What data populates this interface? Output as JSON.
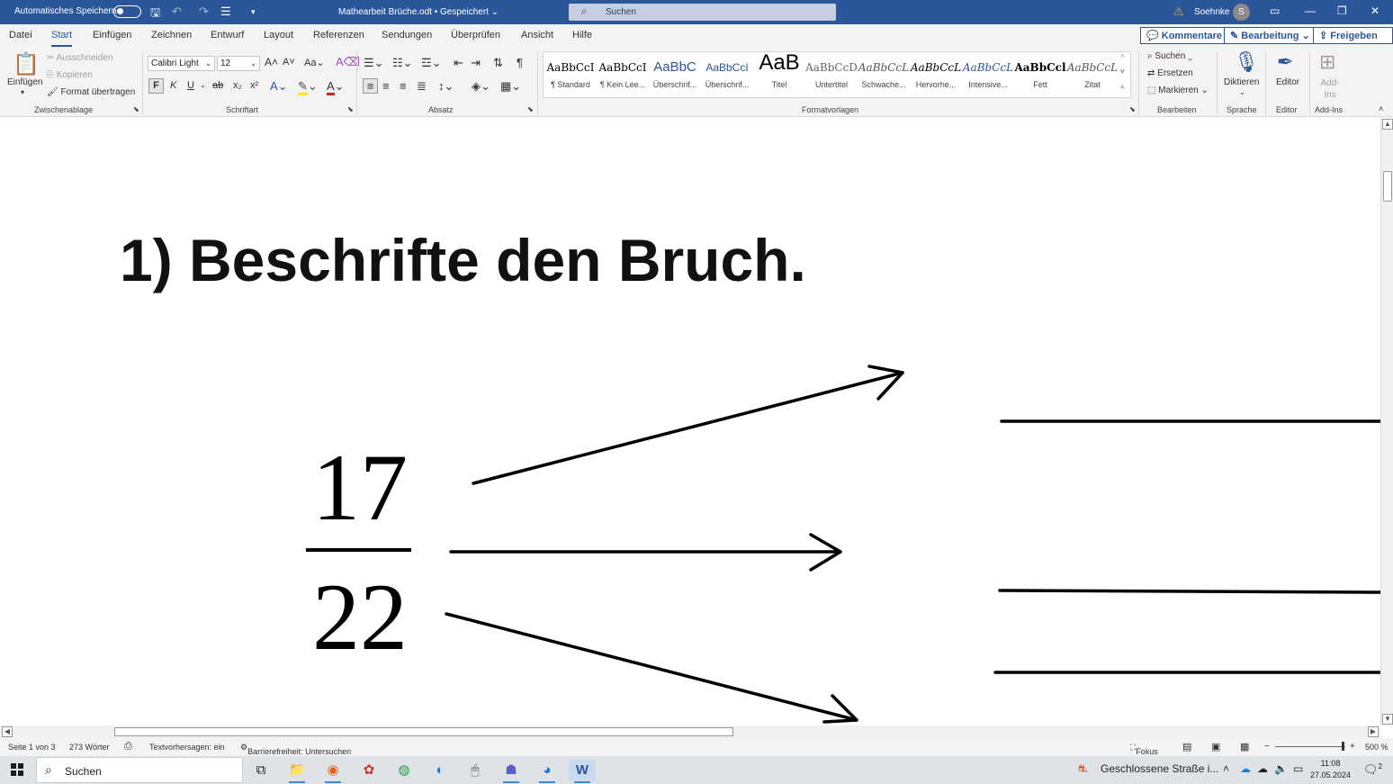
{
  "titlebar": {
    "autosave_label": "Automatisches Speichern",
    "document_title": "Mathearbeit Brüche.odt • Gespeichert ⌄",
    "search_placeholder": "Suchen",
    "user_name": "Soehnke",
    "user_initial": "S"
  },
  "menu": {
    "tabs": [
      "Datei",
      "Start",
      "Einfügen",
      "Zeichnen",
      "Entwurf",
      "Layout",
      "Referenzen",
      "Sendungen",
      "Überprüfen",
      "Ansicht",
      "Hilfe"
    ],
    "active_tab": "Start",
    "comments_button": "Kommentare",
    "editing_button": "Bearbeitung ⌄",
    "share_button": "Freigeben ⌄"
  },
  "ribbon": {
    "clipboard": {
      "paste": "Einfügen",
      "cut": "Ausschneiden",
      "copy": "Kopieren",
      "format_painter": "Format übertragen",
      "label": "Zwischenablage"
    },
    "font": {
      "font_name": "Calibri Light",
      "font_size": "12",
      "bold": "F",
      "italic": "K",
      "underline": "U",
      "label": "Schriftart"
    },
    "paragraph": {
      "label": "Absatz"
    },
    "styles": {
      "label": "Formatvorlagen",
      "items": [
        {
          "preview": "AaBbCcI",
          "name": "¶ Standard"
        },
        {
          "preview": "AaBbCcI",
          "name": "¶ Kein Lee..."
        },
        {
          "preview": "AaBbC",
          "name": "Überschrif..."
        },
        {
          "preview": "AaBbCcI",
          "name": "Überschrif..."
        },
        {
          "preview": "AaB",
          "name": "Titel"
        },
        {
          "preview": "AaBbCcD",
          "name": "Untertitel"
        },
        {
          "preview": "AaBbCcL",
          "name": "Schwache..."
        },
        {
          "preview": "AaBbCcL",
          "name": "Hervorhe..."
        },
        {
          "preview": "AaBbCcL",
          "name": "Intensive..."
        },
        {
          "preview": "AaBbCcl",
          "name": "Fett"
        },
        {
          "preview": "AaBbCcL",
          "name": "Zitat"
        }
      ]
    },
    "editing": {
      "find": "Suchen",
      "replace": "Ersetzen",
      "select": "Markieren",
      "label": "Bearbeiten"
    },
    "voice": {
      "dictate": "Diktieren",
      "label": "Sprache"
    },
    "editor": {
      "editor": "Editor",
      "label": "Editor"
    },
    "addins": {
      "addins": "Add-Ins",
      "label": "Add-Ins"
    }
  },
  "document": {
    "heading": "1) Beschrifte den Bruch.",
    "numerator": "17",
    "denominator": "22"
  },
  "statusbar": {
    "page": "Seite 1 von 3",
    "words": "273 Wörter",
    "text_predictions": "Textvorhersagen: ein",
    "accessibility": "Barrierefreiheit: Untersuchen",
    "focus": "Fokus",
    "zoom": "500 %"
  },
  "taskbar": {
    "search_placeholder": "Suchen",
    "news": "Geschlossene Straße i...",
    "time": "11:08",
    "date": "27.05.2024",
    "notifications_count": "2"
  }
}
